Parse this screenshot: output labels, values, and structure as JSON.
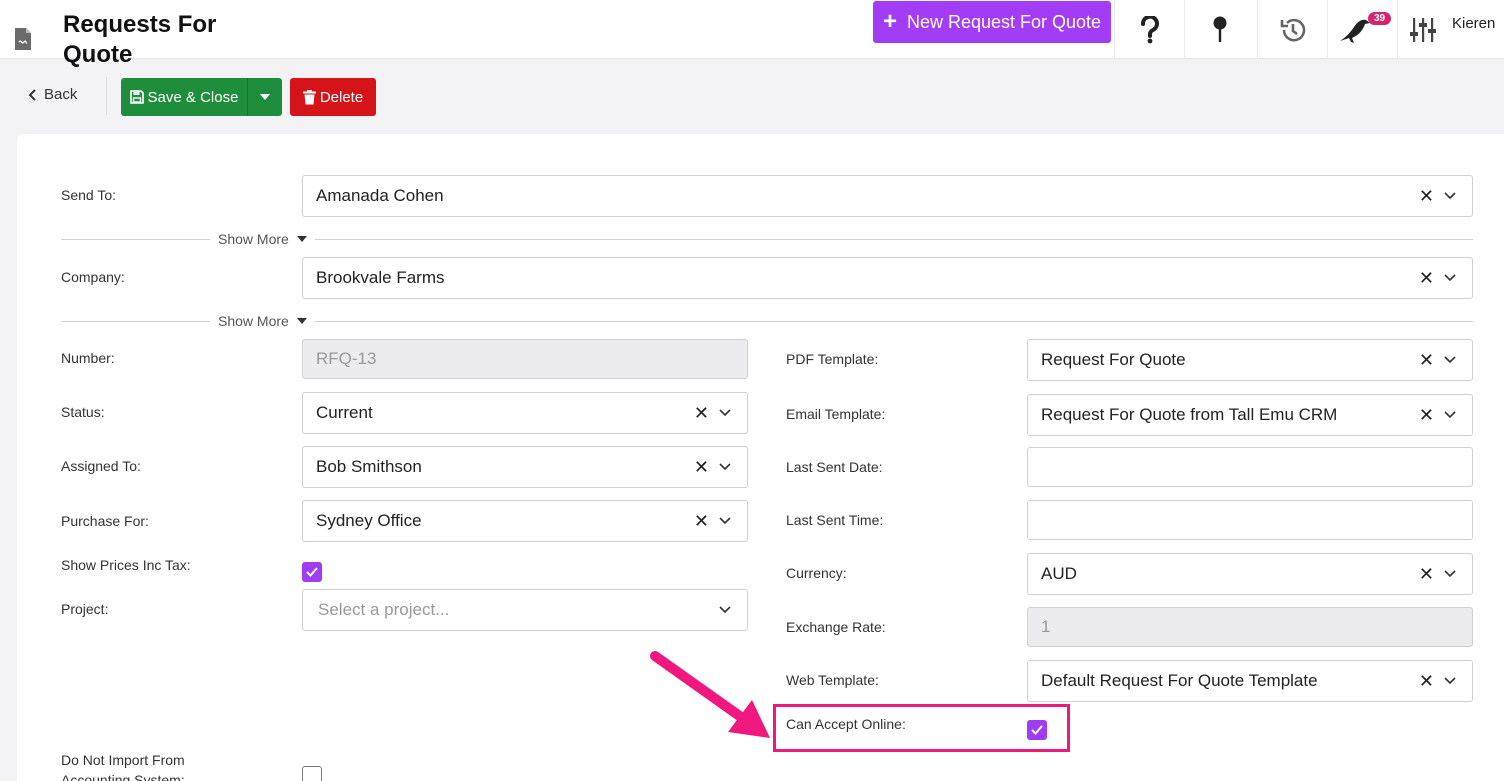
{
  "header": {
    "title": "Requests For Quote",
    "new_button": "New Request For Quote",
    "help_icon": "question-icon",
    "pin_icon": "pin-icon",
    "history_icon": "history-icon",
    "notifications_count": "39",
    "settings_icon": "sliders-icon",
    "user_name": "Kieren"
  },
  "toolbar": {
    "back": "Back",
    "save_close": "Save & Close",
    "delete": "Delete"
  },
  "form": {
    "send_to": {
      "label": "Send To:",
      "value": "Amanada Cohen"
    },
    "show_more_1": "Show More",
    "company": {
      "label": "Company:",
      "value": "Brookvale Farms"
    },
    "show_more_2": "Show More",
    "number": {
      "label": "Number:",
      "value": "RFQ-13"
    },
    "status": {
      "label": "Status:",
      "value": "Current"
    },
    "assigned_to": {
      "label": "Assigned To:",
      "value": "Bob Smithson"
    },
    "purchase_for": {
      "label": "Purchase For:",
      "value": "Sydney Office"
    },
    "show_prices_inc_tax": {
      "label": "Show Prices Inc Tax:",
      "checked": true
    },
    "project": {
      "label": "Project:",
      "placeholder": "Select a project..."
    },
    "do_not_import": {
      "label": "Do Not Import From Accounting System:",
      "checked": false
    },
    "pdf_template": {
      "label": "PDF Template:",
      "value": "Request For Quote"
    },
    "email_template": {
      "label": "Email Template:",
      "value": "Request For Quote from Tall Emu CRM"
    },
    "last_sent_date": {
      "label": "Last Sent Date:",
      "value": ""
    },
    "last_sent_time": {
      "label": "Last Sent Time:",
      "value": ""
    },
    "currency": {
      "label": "Currency:",
      "value": "AUD"
    },
    "exchange_rate": {
      "label": "Exchange Rate:",
      "value": "1"
    },
    "web_template": {
      "label": "Web Template:",
      "value": "Default Request For Quote Template"
    },
    "can_accept_online": {
      "label": "Can Accept Online:",
      "checked": true
    }
  },
  "colors": {
    "accent_purple": "#a33cf5",
    "save_green": "#1f8e3c",
    "delete_red": "#d5141a",
    "annotation_pink": "#f0177e",
    "badge_pink": "#d6246e"
  }
}
